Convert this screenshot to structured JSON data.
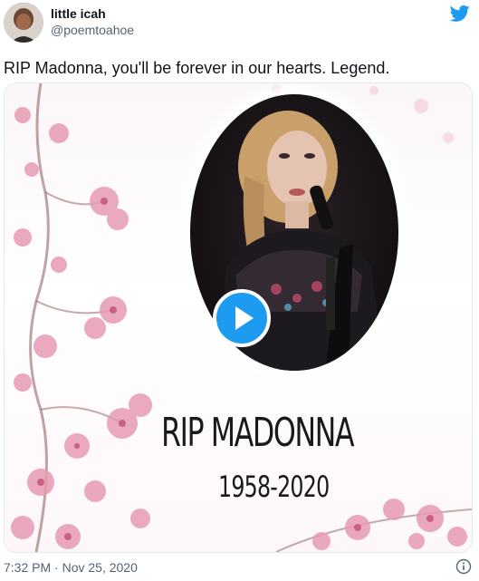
{
  "author": {
    "display_name": "little icah",
    "handle": "@poemtoahoe"
  },
  "tweet": {
    "text": "RIP Madonna, you'll be forever in our hearts. Legend.",
    "time": "7:32 PM",
    "separator": "·",
    "date": "Nov 25, 2020"
  },
  "media": {
    "type": "video",
    "overlay_title": "RIP MADONNA",
    "overlay_years": "1958-2020"
  },
  "icons": {
    "logo": "twitter-bird-icon",
    "play": "play-icon",
    "info": "info-icon"
  },
  "colors": {
    "brand": "#1d9bf0",
    "text": "#0f1419",
    "secondary_text": "#536471",
    "blossom": "#e79bb2"
  }
}
